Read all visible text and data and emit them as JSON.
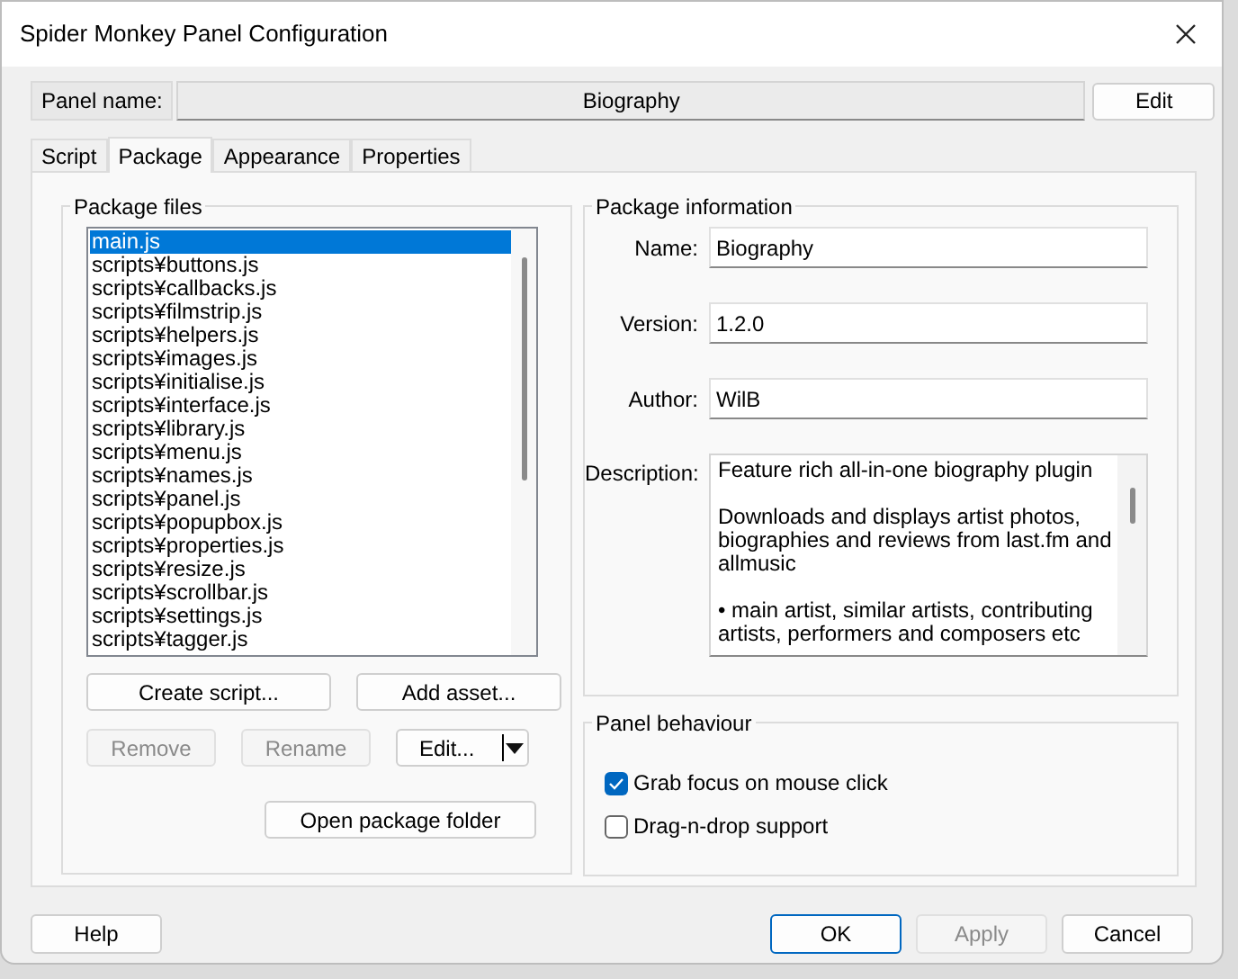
{
  "window": {
    "title": "Spider Monkey Panel Configuration"
  },
  "panel_name": {
    "label": "Panel name:",
    "value": "Biography",
    "button": "Edit"
  },
  "tabs": [
    {
      "label": "Script",
      "selected": false
    },
    {
      "label": "Package",
      "selected": true
    },
    {
      "label": "Appearance",
      "selected": false
    },
    {
      "label": "Properties",
      "selected": false
    }
  ],
  "package_files": {
    "title": "Package files",
    "files": [
      {
        "name": "main.js",
        "selected": true
      },
      {
        "name": "scripts¥buttons.js",
        "selected": false
      },
      {
        "name": "scripts¥callbacks.js",
        "selected": false
      },
      {
        "name": "scripts¥filmstrip.js",
        "selected": false
      },
      {
        "name": "scripts¥helpers.js",
        "selected": false
      },
      {
        "name": "scripts¥images.js",
        "selected": false
      },
      {
        "name": "scripts¥initialise.js",
        "selected": false
      },
      {
        "name": "scripts¥interface.js",
        "selected": false
      },
      {
        "name": "scripts¥library.js",
        "selected": false
      },
      {
        "name": "scripts¥menu.js",
        "selected": false
      },
      {
        "name": "scripts¥names.js",
        "selected": false
      },
      {
        "name": "scripts¥panel.js",
        "selected": false
      },
      {
        "name": "scripts¥popupbox.js",
        "selected": false
      },
      {
        "name": "scripts¥properties.js",
        "selected": false
      },
      {
        "name": "scripts¥resize.js",
        "selected": false
      },
      {
        "name": "scripts¥scrollbar.js",
        "selected": false
      },
      {
        "name": "scripts¥settings.js",
        "selected": false
      },
      {
        "name": "scripts¥tagger.js",
        "selected": false
      }
    ],
    "buttons": [
      {
        "label": "Create script...",
        "disabled": false
      },
      {
        "label": "Add asset...",
        "disabled": false
      },
      {
        "label": "Remove",
        "disabled": true
      },
      {
        "label": "Rename",
        "disabled": true
      }
    ],
    "edit_button": "Edit...",
    "open_folder": "Open package folder"
  },
  "package_info": {
    "title": "Package information",
    "fields": [
      {
        "label": "Name:",
        "value": "Biography"
      },
      {
        "label": "Version:",
        "value": "1.2.0"
      },
      {
        "label": "Author:",
        "value": "WilB"
      }
    ],
    "description": {
      "label": "Description:",
      "paragraphs": [
        "Feature rich all-in-one biography plugin",
        "Downloads and displays artist photos, biographies and reviews from last.fm and allmusic",
        "• main artist, similar artists, contributing artists, performers and composers etc"
      ]
    }
  },
  "panel_behaviour": {
    "title": "Panel behaviour",
    "options": [
      {
        "label": "Grab focus on mouse click",
        "checked": true
      },
      {
        "label": "Drag-n-drop support",
        "checked": false
      }
    ]
  },
  "footer_buttons": [
    {
      "label": "Help",
      "disabled": false,
      "default": false
    },
    {
      "label": "OK",
      "disabled": false,
      "default": true
    },
    {
      "label": "Apply",
      "disabled": true,
      "default": false
    },
    {
      "label": "Cancel",
      "disabled": false,
      "default": false
    }
  ]
}
